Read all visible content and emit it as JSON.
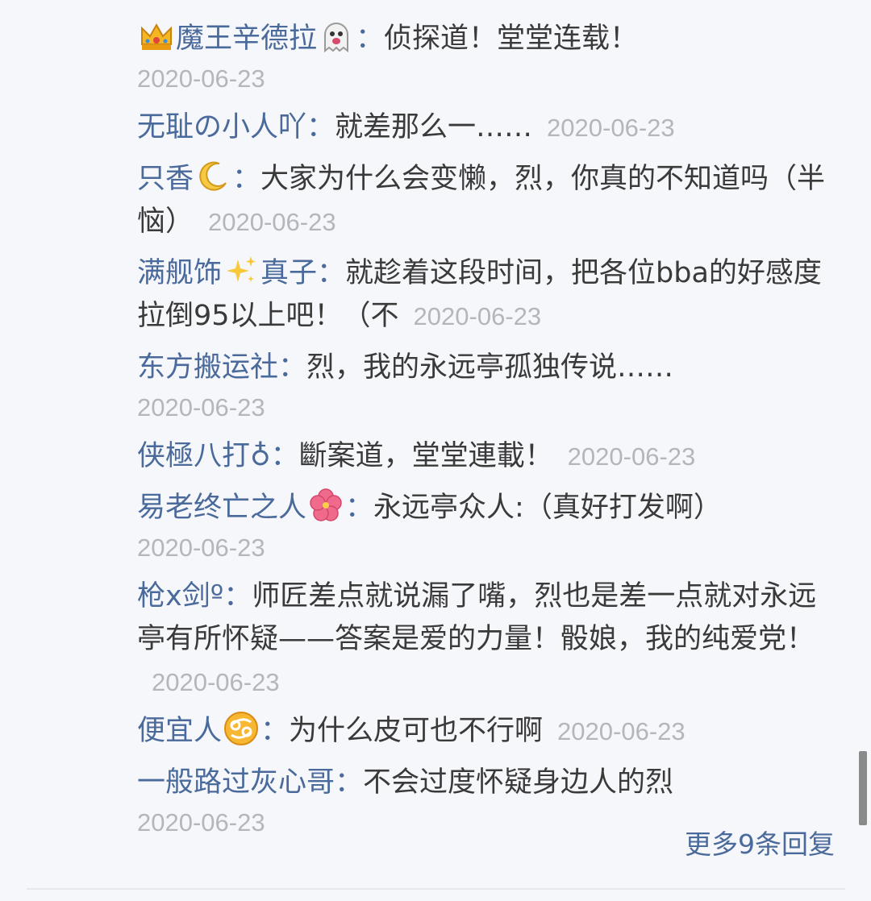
{
  "replies": [
    {
      "name": "魔王辛德拉",
      "colon": "：",
      "text": "侦探道！堂堂连载！",
      "date": "2020-06-23",
      "icons": [
        "crown-icon",
        "ghost-icon"
      ]
    },
    {
      "name": "无耻の小人吖",
      "colon": "：",
      "text": "就差那么一……",
      "date": "2020-06-23"
    },
    {
      "name": "只香",
      "colon": "：",
      "text": "大家为什么会变懒，烈，你真的不知道吗（半恼）",
      "date": "2020-06-23",
      "icons": [
        "crescent-moon-icon"
      ]
    },
    {
      "name_a": "满舰饰",
      "name_b": "真子",
      "colon": "：",
      "text": "就趁着这段时间，把各位bba的好感度拉倒95以上吧！（不",
      "date": "2020-06-23",
      "icons": [
        "sparkles-icon"
      ]
    },
    {
      "name": "东方搬运社",
      "colon": "：",
      "text": "烈，我的永远亭孤独传说……",
      "date": "2020-06-23"
    },
    {
      "name": "侠極八打♁",
      "colon": "：",
      "text": "斷案道，堂堂連載！",
      "date": "2020-06-23"
    },
    {
      "name": "易老终亡之人",
      "colon": "：",
      "text": "永远亭众人:（真好打发啊）",
      "date": "2020-06-23",
      "icons": [
        "hibiscus-icon"
      ]
    },
    {
      "name": "枪x剑º",
      "colon": "：",
      "text": "师匠差点就说漏了嘴，烈也是差一点就对永远亭有所怀疑——答案是爱的力量！骰娘，我的纯爱党！",
      "date": "2020-06-23"
    },
    {
      "name": "便宜人",
      "colon": "：",
      "text": "为什么皮可也不行啊",
      "date": "2020-06-23",
      "icons": [
        "cancer-sign-icon"
      ]
    },
    {
      "name": "一般路过灰心哥",
      "colon": "：",
      "text": "不会过度怀疑身边人的烈",
      "date": "2020-06-23"
    }
  ],
  "more_replies_label": "更多9条回复",
  "colors": {
    "username": "#4a6a9c",
    "text": "#3a3a3a",
    "date": "#b3b6bc",
    "background": "#f6f7fa"
  }
}
